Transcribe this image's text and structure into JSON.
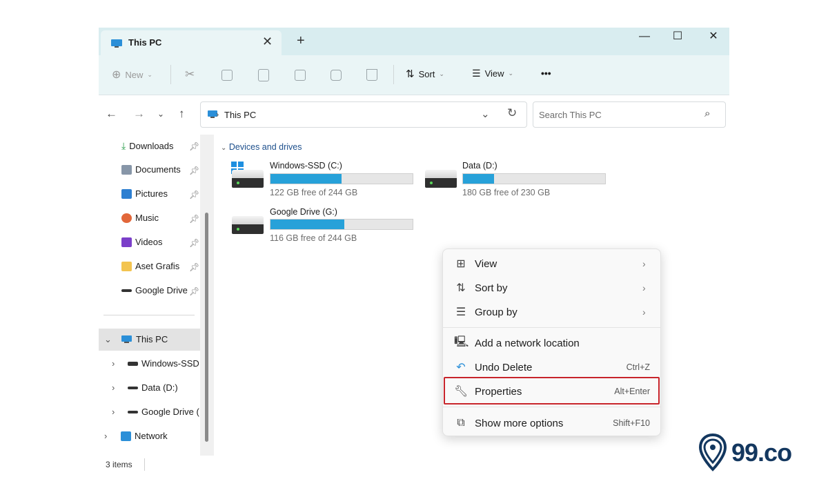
{
  "window": {
    "tab_title": "This PC",
    "tab_close": "✕",
    "new_tab": "+",
    "minimize": "—",
    "maximize": "☐",
    "close": "✕"
  },
  "toolbar": {
    "new_label": "New",
    "sort_label": "Sort",
    "view_label": "View",
    "more": "•••"
  },
  "address": {
    "path": "This PC",
    "separator": "›",
    "search_placeholder": "Search This PC"
  },
  "sidebar": {
    "quick_access": [
      {
        "label": "Downloads",
        "icon": "download-icon"
      },
      {
        "label": "Documents",
        "icon": "documents-icon"
      },
      {
        "label": "Pictures",
        "icon": "pictures-icon"
      },
      {
        "label": "Music",
        "icon": "music-icon"
      },
      {
        "label": "Videos",
        "icon": "videos-icon"
      },
      {
        "label": "Aset Grafis",
        "icon": "folder-icon"
      },
      {
        "label": "Google Drive",
        "icon": "drive-icon"
      }
    ],
    "tree": {
      "this_pc": "This PC",
      "children": [
        "Windows-SSD",
        "Data (D:)",
        "Google Drive ("
      ],
      "network": "Network"
    }
  },
  "content": {
    "group_header": "Devices and drives",
    "drives": [
      {
        "name": "Windows-SSD (C:)",
        "free_text": "122 GB free of 244 GB",
        "used_fraction": 0.5
      },
      {
        "name": "Data (D:)",
        "free_text": "180 GB free of 230 GB",
        "used_fraction": 0.22
      },
      {
        "name": "Google Drive (G:)",
        "free_text": "116 GB free of 244 GB",
        "used_fraction": 0.52
      }
    ]
  },
  "status_bar": {
    "items_count": "3 items"
  },
  "context_menu": {
    "items": [
      {
        "label": "View",
        "icon": "view-grid-icon",
        "shortcut": ""
      },
      {
        "label": "Sort by",
        "icon": "sort-icon",
        "shortcut": ""
      },
      {
        "label": "Group by",
        "icon": "group-icon",
        "shortcut": ""
      },
      {
        "label": "Add a network location",
        "icon": "network-location-icon",
        "shortcut": ""
      },
      {
        "label": "Undo Delete",
        "icon": "undo-icon",
        "shortcut": "Ctrl+Z"
      },
      {
        "label": "Properties",
        "icon": "properties-wrench-icon",
        "shortcut": "Alt+Enter"
      },
      {
        "label": "Show more options",
        "icon": "more-options-icon",
        "shortcut": "Shift+F10"
      }
    ]
  },
  "brand": {
    "text": "99.co"
  },
  "colors": {
    "accent": "#27a1d9",
    "highlight_border": "#c8242b",
    "titlebar": "#d9edf0",
    "brand_navy": "#13375f"
  }
}
